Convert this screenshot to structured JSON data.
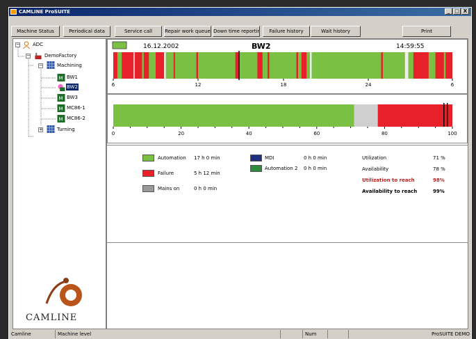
{
  "window": {
    "title": "CAMLINE ProSUITE",
    "controls": [
      "_",
      "□",
      "X"
    ]
  },
  "toolbar": {
    "buttons": [
      "Machine Status",
      "Periodical data",
      "Service call",
      "Repair work queue",
      "Down time reporting",
      "Failure history",
      "Wait history",
      "Print"
    ]
  },
  "tree": {
    "root": "ADC",
    "factory": "DemoFactory",
    "group": "Machining",
    "machines": [
      "BW1",
      "BW2",
      "BW3",
      "MC86-1",
      "MC86-2"
    ],
    "group2": "Turning"
  },
  "timeline": {
    "date": "16.12.2002",
    "machine": "BW2",
    "time": "14:59:55",
    "ticks": [
      "6",
      "12",
      "18",
      "24",
      "6"
    ]
  },
  "bar": {
    "ticks": [
      "0",
      "20",
      "40",
      "60",
      "80",
      "100"
    ]
  },
  "legend": {
    "left": [
      {
        "label": "Automation",
        "value": "17 h 0 min",
        "color": "#7ac143"
      },
      {
        "label": "Failure",
        "value": "5 h 12 min",
        "color": "#e8202a"
      },
      {
        "label": "Mains on",
        "value": "0 h 0 min",
        "color": "#9a9a9a"
      }
    ],
    "mid": [
      {
        "label": "MDI",
        "value": "0 h 0 min",
        "color": "#1f2f7f"
      },
      {
        "label": "Automation 2",
        "value": "0 h 0 min",
        "color": "#2e8b3e"
      }
    ],
    "kpi": [
      {
        "label": "Utilization",
        "value": "71 %"
      },
      {
        "label": "Availability",
        "value": "78 %"
      },
      {
        "label": "Utilization to reach",
        "value": "98%"
      },
      {
        "label": "Availability to reach",
        "value": "99%"
      }
    ]
  },
  "logo": {
    "text": "CAMLINE"
  },
  "status": {
    "cells": [
      "Camline",
      "Machine level",
      "",
      "Num",
      "",
      "ProSUITE DEMO"
    ]
  },
  "colors": {
    "automation": "#7ac143",
    "failure": "#e8202a",
    "mains": "#cfcfcf",
    "selection": "#0a246a"
  }
}
